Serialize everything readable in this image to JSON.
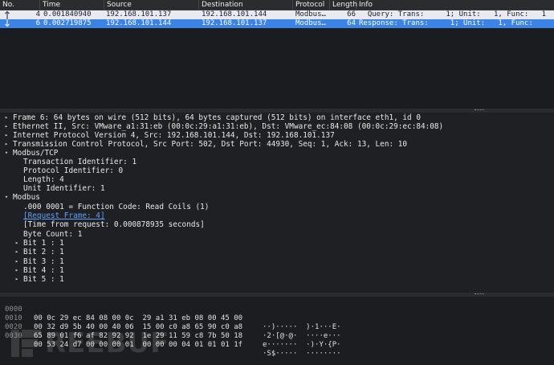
{
  "packet_list": {
    "columns": [
      "No.",
      "Time",
      "Source",
      "Destination",
      "Protocol",
      "Length",
      "Info"
    ],
    "rows": [
      {
        "no": "4",
        "time": "0.001840940",
        "source": "192.168.101.137",
        "destination": "192.168.101.144",
        "protocol": "Modbus…",
        "length": "66",
        "info": "  Query: Trans:     1; Unit:   1, Func:   1"
      },
      {
        "no": "6",
        "time": "0.002719875",
        "source": "192.168.101.144",
        "destination": "192.168.101.137",
        "protocol": "Modbus…",
        "length": "64",
        "info": "Response: Trans:     1; Unit:   1, Func:"
      }
    ]
  },
  "details": {
    "frame": "Frame 6: 64 bytes on wire (512 bits), 64 bytes captured (512 bits) on interface eth1, id 0",
    "ethernet": "Ethernet II, Src: VMware_a1:31:eb (00:0c:29:a1:31:eb), Dst: VMware_ec:84:08 (00:0c:29:ec:84:08)",
    "ip": "Internet Protocol Version 4, Src: 192.168.101.144, Dst: 192.168.101.137",
    "tcp": "Transmission Control Protocol, Src Port: 502, Dst Port: 44930, Seq: 1, Ack: 13, Len: 10",
    "modbus_tcp": "Modbus/TCP",
    "transaction_id": "Transaction Identifier: 1",
    "protocol_id": "Protocol Identifier: 0",
    "length": "Length: 4",
    "unit_id": "Unit Identifier: 1",
    "modbus": "Modbus",
    "function_code": ".000 0001 = Function Code: Read Coils (1)",
    "request_frame": "[Request Frame: 4]",
    "time_from_request": "[Time from request: 0.000878935 seconds]",
    "byte_count": "Byte Count: 1",
    "bits": [
      "Bit 1 : 1",
      "Bit 2 : 1",
      "Bit 3 : 1",
      "Bit 4 : 1",
      "Bit 5 : 1"
    ]
  },
  "bytes": [
    {
      "offset": "0000",
      "hex": "00 0c 29 ec 84 08 00 0c  29 a1 31 eb 08 00 45 00",
      "ascii": "··)·····  )·1···E·"
    },
    {
      "offset": "0010",
      "hex": "00 32 d9 5b 40 00 40 06  15 00 c0 a8 65 90 c0 a8",
      "ascii": "·2·[@·@·  ····e···"
    },
    {
      "offset": "0020",
      "hex": "65 89 01 f6 af 82 92 92  1e 29 11 59 c8 7b 50 18",
      "ascii": "e·······  ·)·Y·{P·"
    },
    {
      "offset": "0030",
      "hex": "00 53 24 d7 00 00 00 01  00 00 00 04 01 01 01 1f",
      "ascii": "·S$·····  ········"
    }
  ],
  "watermark": "REEBUF",
  "colors": {
    "selected_row": "#3b84e6",
    "related_row": "#e9e9f2",
    "background": "#202124",
    "link": "#5da0ff"
  }
}
